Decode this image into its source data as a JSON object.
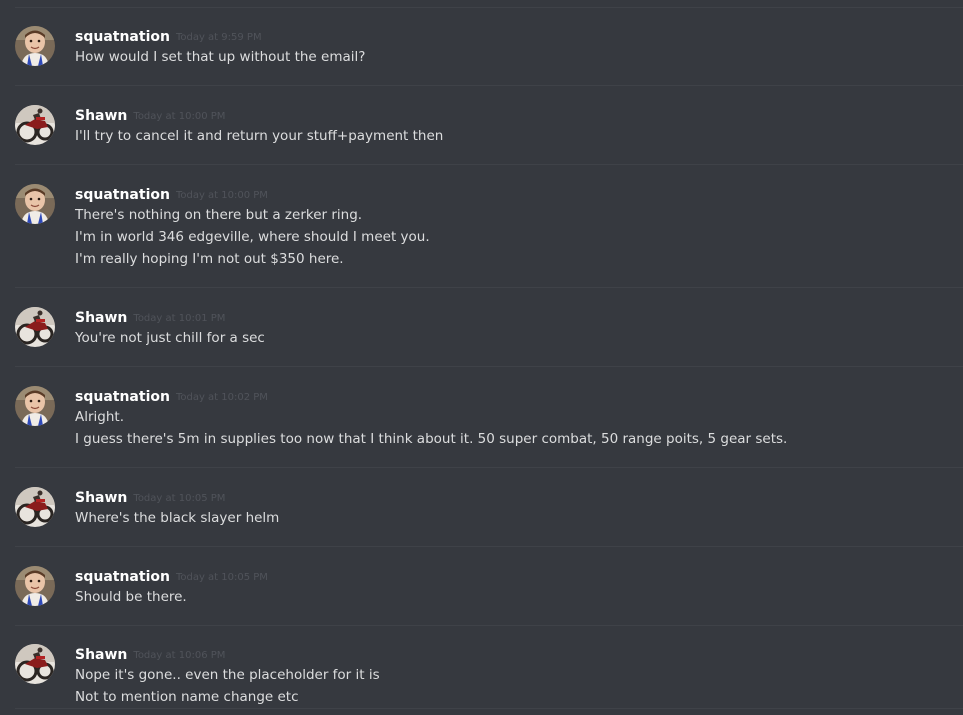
{
  "messages": [
    {
      "author": "squatnation",
      "avatar": "kid-avatar-icon",
      "timestamp": "Today at 9:59 PM",
      "lines": [
        "How would I set that up without the email?"
      ]
    },
    {
      "author": "Shawn",
      "avatar": "motorcycle-avatar-icon",
      "timestamp": "Today at 10:00 PM",
      "lines": [
        "I'll try to cancel it and return your stuff+payment then"
      ]
    },
    {
      "author": "squatnation",
      "avatar": "kid-avatar-icon",
      "timestamp": "Today at 10:00 PM",
      "lines": [
        "There's nothing on there but a zerker ring.",
        "I'm in world 346 edgeville, where should I meet you.",
        "I'm really hoping I'm not out $350 here."
      ]
    },
    {
      "author": "Shawn",
      "avatar": "motorcycle-avatar-icon",
      "timestamp": "Today at 10:01 PM",
      "lines": [
        "You're not just chill for a sec"
      ]
    },
    {
      "author": "squatnation",
      "avatar": "kid-avatar-icon",
      "timestamp": "Today at 10:02 PM",
      "lines": [
        "Alright.",
        "I guess there's 5m in supplies too now that I think about it.  50 super combat, 50 range poits, 5 gear sets."
      ]
    },
    {
      "author": "Shawn",
      "avatar": "motorcycle-avatar-icon",
      "timestamp": "Today at 10:05 PM",
      "lines": [
        "Where's the black slayer helm"
      ]
    },
    {
      "author": "squatnation",
      "avatar": "kid-avatar-icon",
      "timestamp": "Today at 10:05 PM",
      "lines": [
        "Should be there."
      ]
    },
    {
      "author": "Shawn",
      "avatar": "motorcycle-avatar-icon",
      "timestamp": "Today at 10:06 PM",
      "lines": [
        "Nope it's gone.. even the placeholder for it is",
        "Not to mention name change etc"
      ]
    }
  ]
}
